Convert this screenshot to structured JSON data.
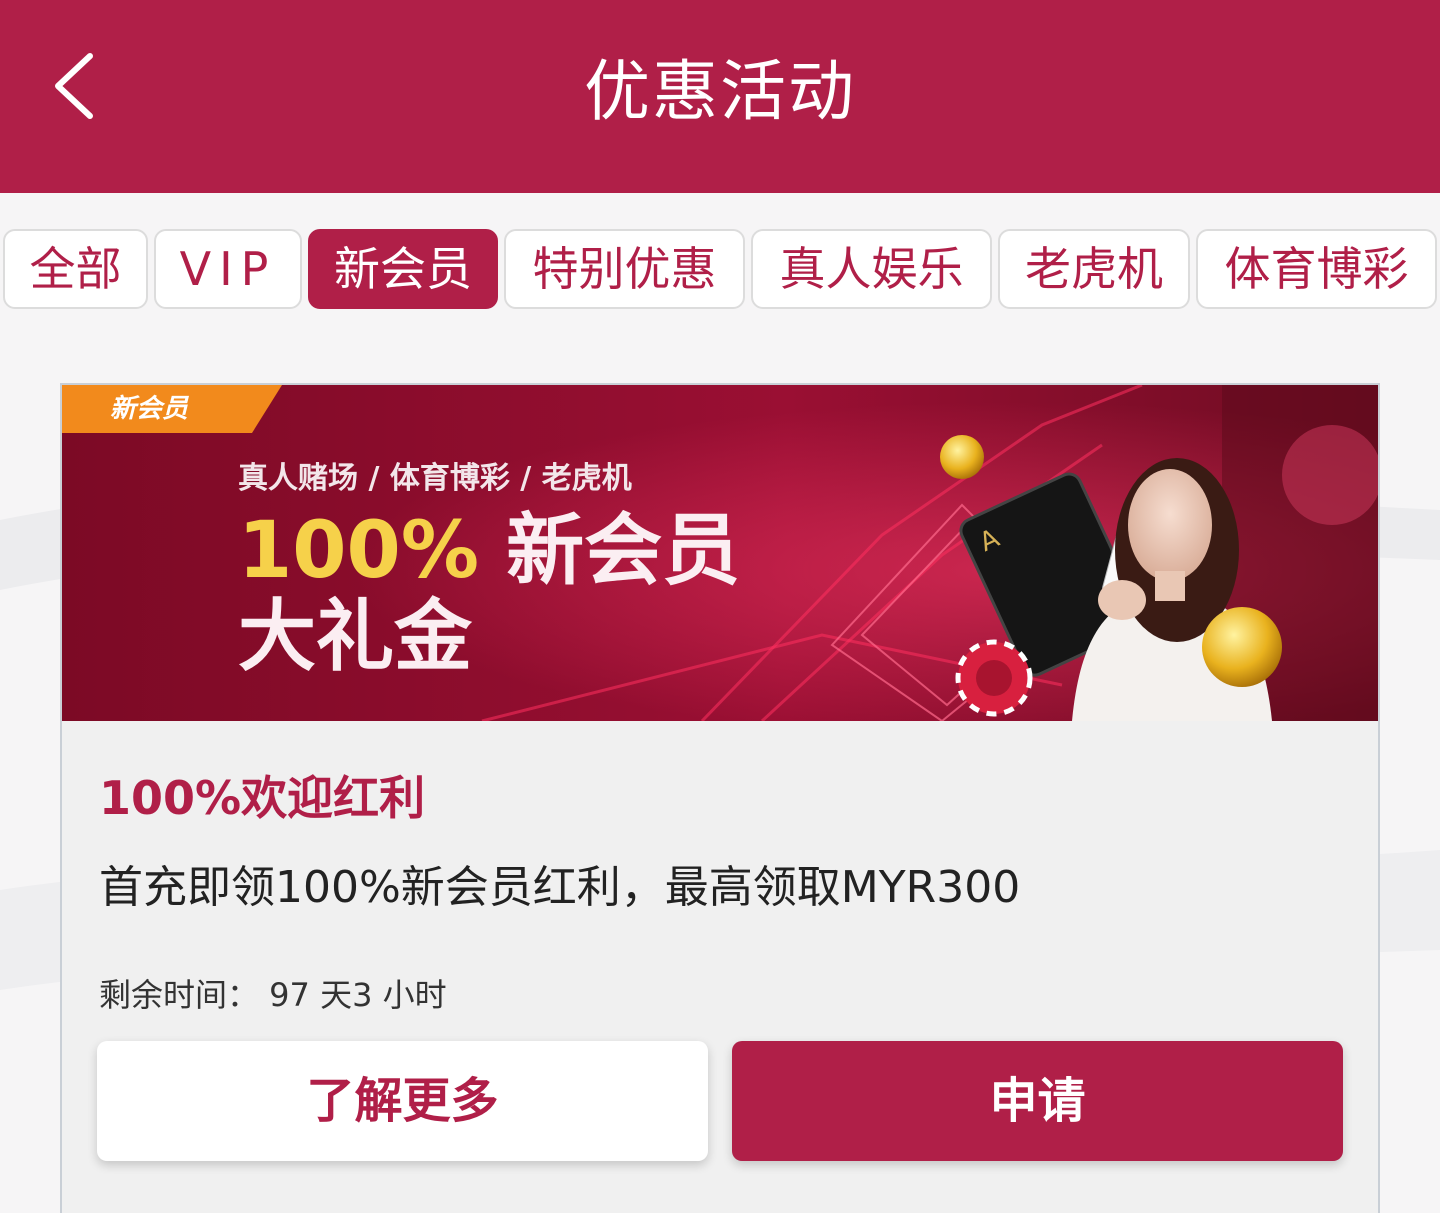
{
  "header": {
    "title": "优惠活动",
    "background_color": "#b01f48",
    "back_icon": "chevron-left-icon"
  },
  "tabs": [
    {
      "label": "全部",
      "active": false
    },
    {
      "label": "VIP",
      "active": false
    },
    {
      "label": "新会员",
      "active": true
    },
    {
      "label": "特别优惠",
      "active": false
    },
    {
      "label": "真人娱乐",
      "active": false
    },
    {
      "label": "老虎机",
      "active": false
    },
    {
      "label": "体育博彩",
      "active": false
    }
  ],
  "promotion": {
    "banner": {
      "tag": "新会员",
      "subtitle": "真人赌场 / 体育博彩 / 老虎机",
      "headline_percent": "100%",
      "headline_rest": "新会员",
      "headline_line2": "大礼金"
    },
    "title": "100%欢迎红利",
    "description": "首充即领100%新会员红利，最高领取MYR300",
    "countdown": "剩余时间： 97 天3 小时",
    "learn_more_label": "了解更多",
    "apply_label": "申请"
  },
  "colors": {
    "accent": "#b01f48",
    "tag_orange": "#f28a1c",
    "headline_yellow": "#f6d14a"
  }
}
